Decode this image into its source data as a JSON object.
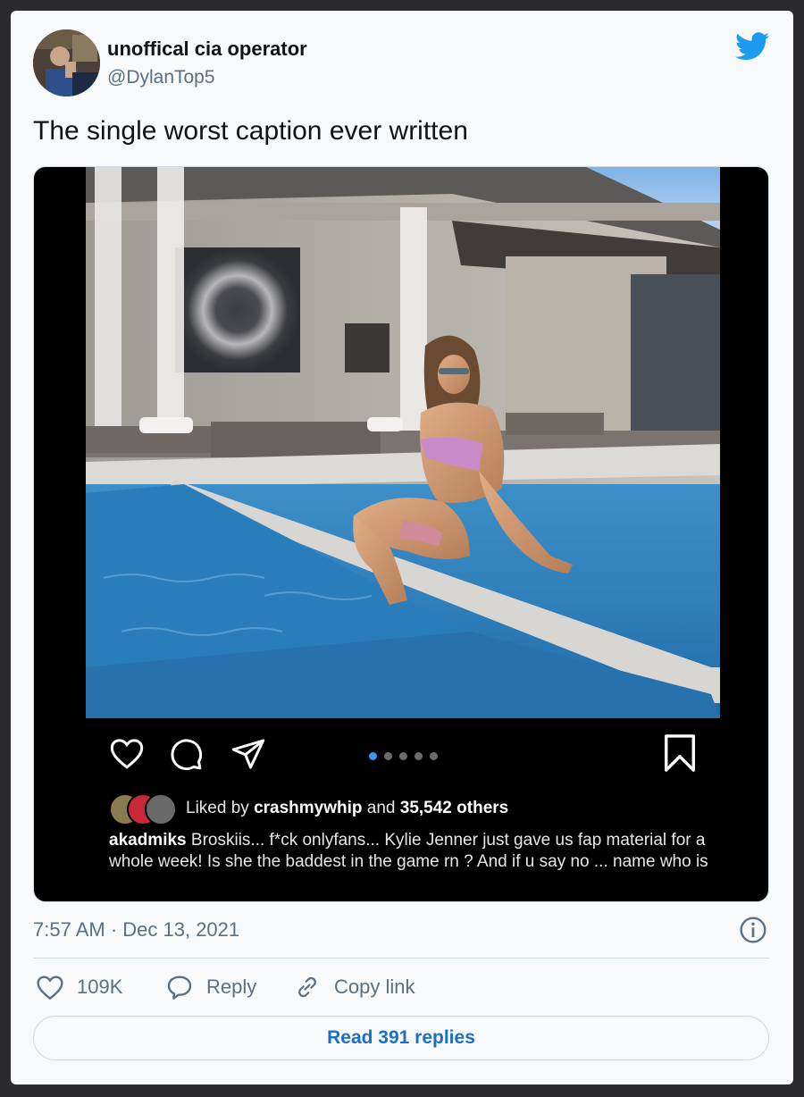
{
  "tweet": {
    "author_name": "unoffical cia operator",
    "author_handle": "@DylanTop5",
    "text": "The single worst caption ever written",
    "timestamp": "7:57 AM · Dec 13, 2021"
  },
  "media": {
    "instagram": {
      "liked_prefix": "Liked by",
      "liked_user": "crashmywhip",
      "liked_and": "and",
      "liked_others": "35,542 others",
      "caption_user": "akadmiks",
      "caption_text": "Broskiis... f*ck onlyfans... Kylie Jenner just gave us fap material for a whole week! Is she the baddest in the game rn ? And if u say no ... name who is",
      "carousel_active_index": 0,
      "carousel_count": 5
    }
  },
  "actions": {
    "likes_count": "109K",
    "reply_label": "Reply",
    "copy_link_label": "Copy link",
    "read_replies_label": "Read 391 replies"
  },
  "icons": {
    "brand": "twitter-bird-icon",
    "info": "info-icon",
    "like": "heart-icon",
    "reply": "speech-bubble-icon",
    "copy": "link-icon"
  },
  "colors": {
    "twitter_blue": "#1d9bf0",
    "link_blue": "#1b6fc7",
    "muted_text": "#5b7083",
    "instagram_active_dot": "#3897f0"
  }
}
